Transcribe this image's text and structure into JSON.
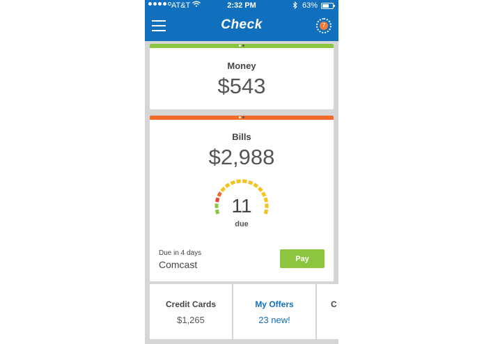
{
  "status_bar": {
    "carrier": "AT&T",
    "time": "2:32 PM",
    "battery_percent": "63%"
  },
  "nav": {
    "title": "Check",
    "notification_count": "7"
  },
  "money_card": {
    "label": "Money",
    "amount": "$543"
  },
  "bills_card": {
    "label": "Bills",
    "amount": "$2,988",
    "gauge_count": "11",
    "gauge_caption": "due",
    "due_in": "Due in 4 days",
    "payee": "Comcast",
    "pay_label": "Pay"
  },
  "tiles": [
    {
      "label": "Credit Cards",
      "value": "$1,265"
    },
    {
      "label": "My Offers",
      "value": "23 new!"
    },
    {
      "label": "C",
      "value": ""
    }
  ],
  "colors": {
    "brand_blue": "#1170bd",
    "money_green": "#8cc63f",
    "bills_orange": "#f26b2a",
    "gauge_yellow": "#f5c21b",
    "gauge_red": "#e2483c"
  }
}
